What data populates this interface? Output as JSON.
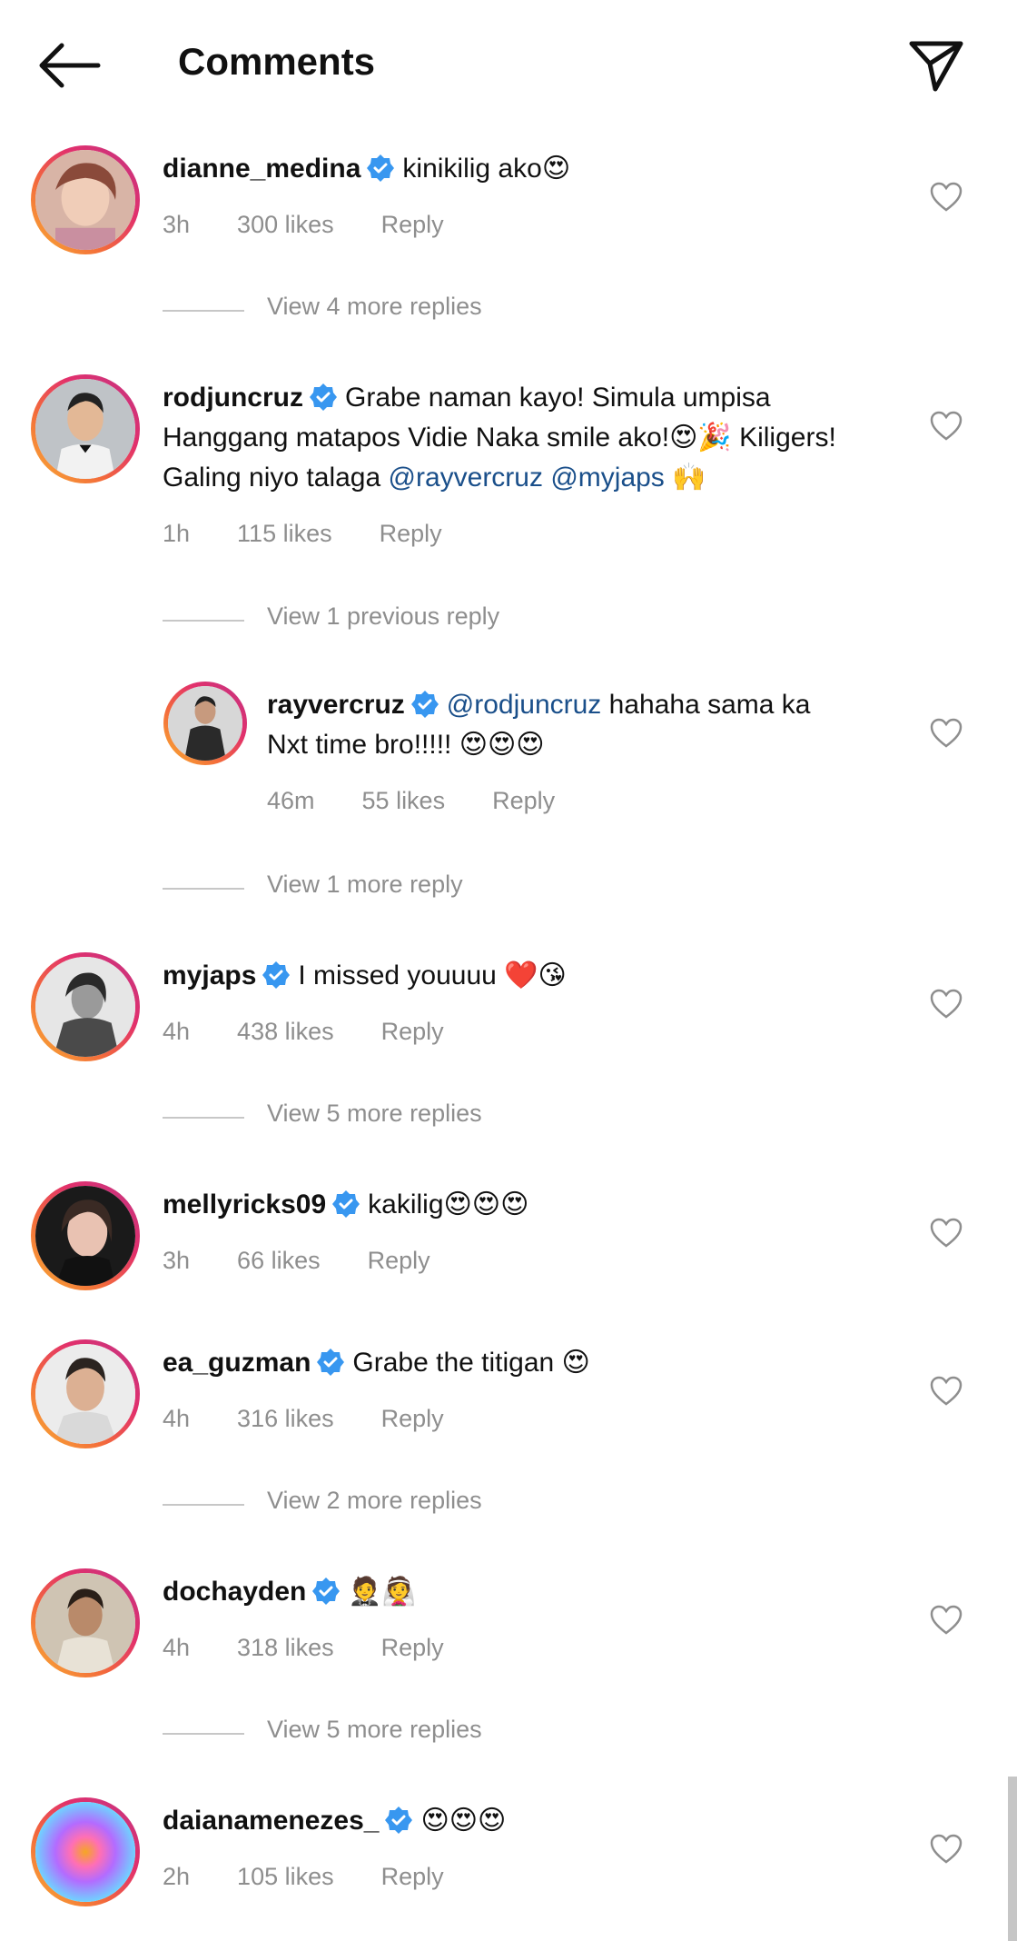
{
  "header": {
    "title": "Comments"
  },
  "comments": [
    {
      "username": "dianne_medina",
      "text": "kinikilig ako",
      "emojis": "😍",
      "time": "3h",
      "likes": "300 likes",
      "reply": "Reply",
      "view_more": "View 4 more replies"
    },
    {
      "username": "rodjuncruz",
      "text_line1": "Grabe naman kayo! Simula umpisa",
      "text_line2": "Hanggang matapos Vidie Naka smile ako!",
      "emojis_line2": "😍🎉",
      "text_line2b": " Kiligers!",
      "text_line3": "Galing niyo talaga ",
      "mention1": "@rayvercruz",
      "mention2": "@myjaps",
      "emojis_line3": "🙌",
      "time": "1h",
      "likes": "115 likes",
      "reply": "Reply",
      "view_more": "View 1 previous reply"
    },
    {
      "username": "rayvercruz",
      "mention": "@rodjuncruz",
      "text_line1": " hahaha sama ka",
      "text_line2": "Nxt time bro!!!!! ",
      "emojis": "😍😍😍",
      "time": "46m",
      "likes": "55 likes",
      "reply": "Reply",
      "view_more": "View 1 more reply"
    },
    {
      "username": "myjaps",
      "text": "I missed youuuu ",
      "emojis": "❤️😘",
      "time": "4h",
      "likes": "438 likes",
      "reply": "Reply",
      "view_more": "View 5 more replies"
    },
    {
      "username": "mellyricks09",
      "text": "kakilig",
      "emojis": "😍😍😍",
      "time": "3h",
      "likes": "66 likes",
      "reply": "Reply"
    },
    {
      "username": "ea_guzman",
      "text": "Grabe the titigan ",
      "emojis": "😍",
      "time": "4h",
      "likes": "316 likes",
      "reply": "Reply",
      "view_more": "View 2 more replies"
    },
    {
      "username": "dochayden",
      "text": "",
      "emojis": "🤵👰",
      "time": "4h",
      "likes": "318 likes",
      "reply": "Reply",
      "view_more": "View 5 more replies"
    },
    {
      "username": "daianamenezes_",
      "text": "",
      "emojis": "😍😍😍",
      "time": "2h",
      "likes": "105 likes",
      "reply": "Reply"
    }
  ],
  "icons": {
    "back": "arrow-left-icon",
    "send": "paper-plane-icon",
    "verified": "verified-badge-icon",
    "like": "heart-outline-icon"
  },
  "colors": {
    "verified": "#3897f0",
    "mention": "#1a4f8a",
    "meta": "#8e8e8e",
    "story_ring_start": "#f9b233",
    "story_ring_end": "#c13584"
  }
}
